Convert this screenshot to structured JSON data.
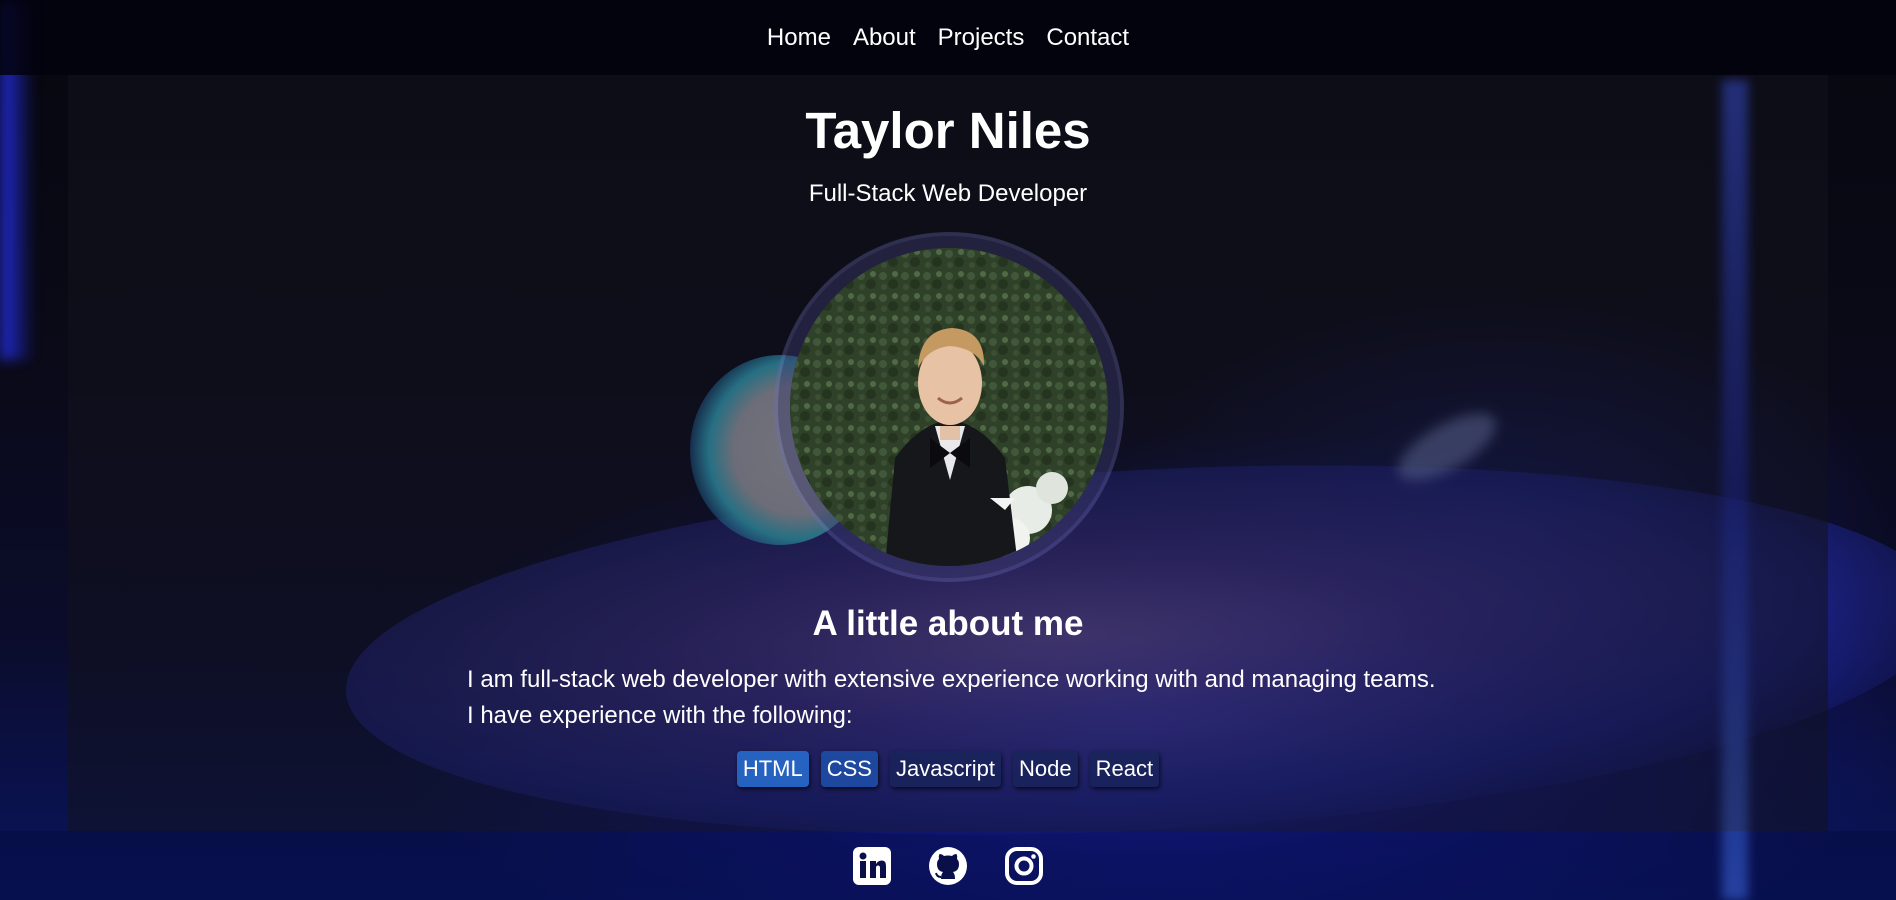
{
  "nav": {
    "items": [
      {
        "label": "Home"
      },
      {
        "label": "About"
      },
      {
        "label": "Projects"
      },
      {
        "label": "Contact"
      }
    ]
  },
  "header": {
    "name": "Taylor Niles",
    "role": "Full-Stack Web Developer"
  },
  "about": {
    "heading": "A little about me",
    "line1": "I am full-stack web developer with extensive experience working with and managing teams.",
    "line2": "I have experience with the following:",
    "skills": [
      "HTML",
      "CSS",
      "Javascript",
      "Node",
      "React"
    ]
  },
  "footer": {
    "icons": [
      "linkedin-icon",
      "github-icon",
      "instagram-icon"
    ]
  },
  "colors": {
    "text": "#ffffff",
    "accent": "#2833d2"
  }
}
